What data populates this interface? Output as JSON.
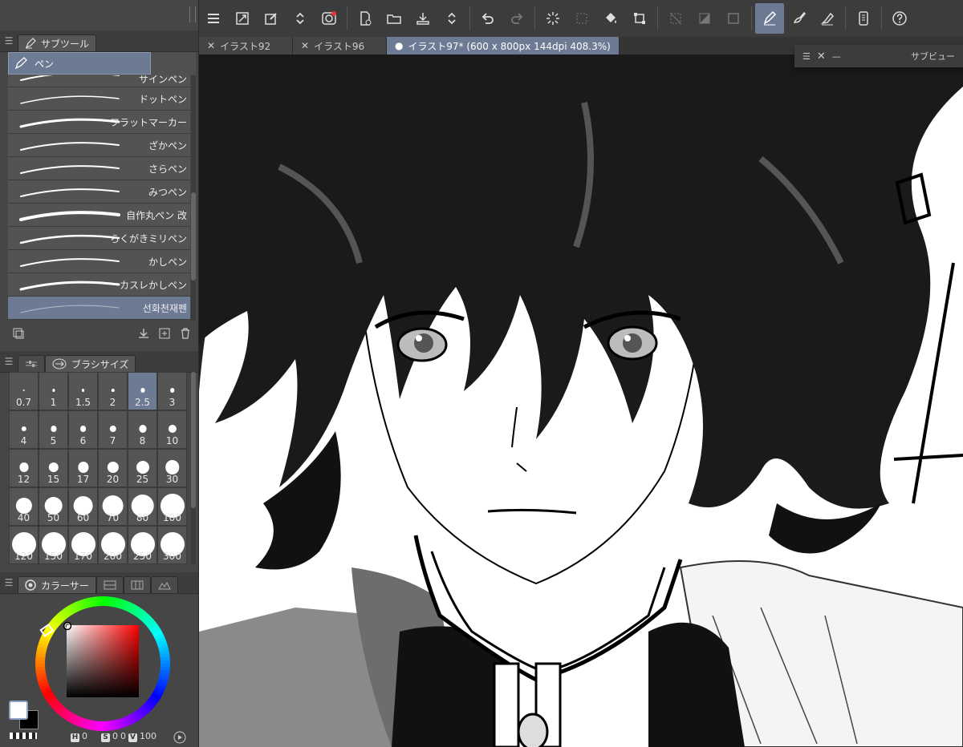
{
  "subtool": {
    "tab_label": "サブツール",
    "group_label": "ペン",
    "brushes": [
      {
        "name": "サインペン"
      },
      {
        "name": "ドットペン"
      },
      {
        "name": "フラットマーカー"
      },
      {
        "name": "ざかペン"
      },
      {
        "name": "さらペン"
      },
      {
        "name": "みつペン"
      },
      {
        "name": "自作丸ペン 改"
      },
      {
        "name": "らくがきミリペン"
      },
      {
        "name": "かしペン"
      },
      {
        "name": "カスレかしペン"
      },
      {
        "name": "선화천재펜"
      }
    ],
    "selected_index": 10
  },
  "brush_size": {
    "tab_label": "ブラシサイズ",
    "sizes": [
      "0.7",
      "1",
      "1.5",
      "2",
      "2.5",
      "3",
      "4",
      "5",
      "6",
      "7",
      "8",
      "10",
      "12",
      "15",
      "17",
      "20",
      "25",
      "30",
      "40",
      "50",
      "60",
      "70",
      "80",
      "100",
      "120",
      "150",
      "170",
      "200",
      "250",
      "300"
    ],
    "selected": "2.5"
  },
  "color": {
    "tab_label": "カラーサー",
    "h_label": "H",
    "h": "0",
    "s_label": "S",
    "s": "0",
    "v_label": "V",
    "v": "100",
    "main_color": "#ffffff",
    "sub_color": "#000000",
    "accent": "#6c7a93"
  },
  "doc_tabs": [
    {
      "label": "イラスト92",
      "active": false
    },
    {
      "label": "イラスト96",
      "active": false
    },
    {
      "label": "イラスト97* (600 x 800px 144dpi 408.3%)",
      "active": true
    }
  ],
  "subview": {
    "label": "サブビュー"
  },
  "toolbar_icons": [
    "menu-icon",
    "resize-icon",
    "eyedropper-icon",
    "updown-icon",
    "spiral-icon",
    "new-file-icon",
    "open-folder-icon",
    "save-icon",
    "updown-icon",
    "undo-icon",
    "redo-icon",
    "loading-icon",
    "select-icon",
    "fill-icon",
    "transform-icon",
    "deselect-icon",
    "gradient-icon",
    "frame-icon",
    "pen-tool-icon",
    "brush-tool-icon",
    "eraser-icon",
    "device-icon",
    "help-icon"
  ]
}
